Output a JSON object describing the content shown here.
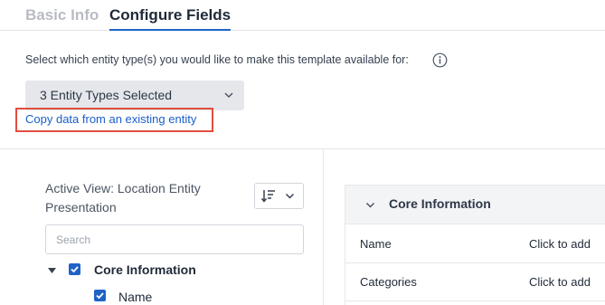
{
  "tabs": [
    {
      "label": "Basic Info",
      "active": false
    },
    {
      "label": "Configure Fields",
      "active": true
    }
  ],
  "entity": {
    "prompt": "Select which entity type(s) you would like to make this template available for:",
    "selected_label": "3 Entity Types Selected",
    "copy_link": "Copy data from an existing entity"
  },
  "left_panel": {
    "active_view": "Active View: Location Entity Presentation",
    "search_placeholder": "Search",
    "tree": {
      "group_label": "Core Information",
      "group_checked": true,
      "items": [
        {
          "label": "Name",
          "checked": true
        }
      ]
    }
  },
  "right_panel": {
    "section_title": "Core Information",
    "fields": [
      {
        "name": "Name",
        "action": "Click to add"
      },
      {
        "name": "Categories",
        "action": "Click to add"
      }
    ]
  },
  "colors": {
    "accent": "#1f63c6",
    "link": "#1a5fc7",
    "highlight": "#e14d40"
  }
}
